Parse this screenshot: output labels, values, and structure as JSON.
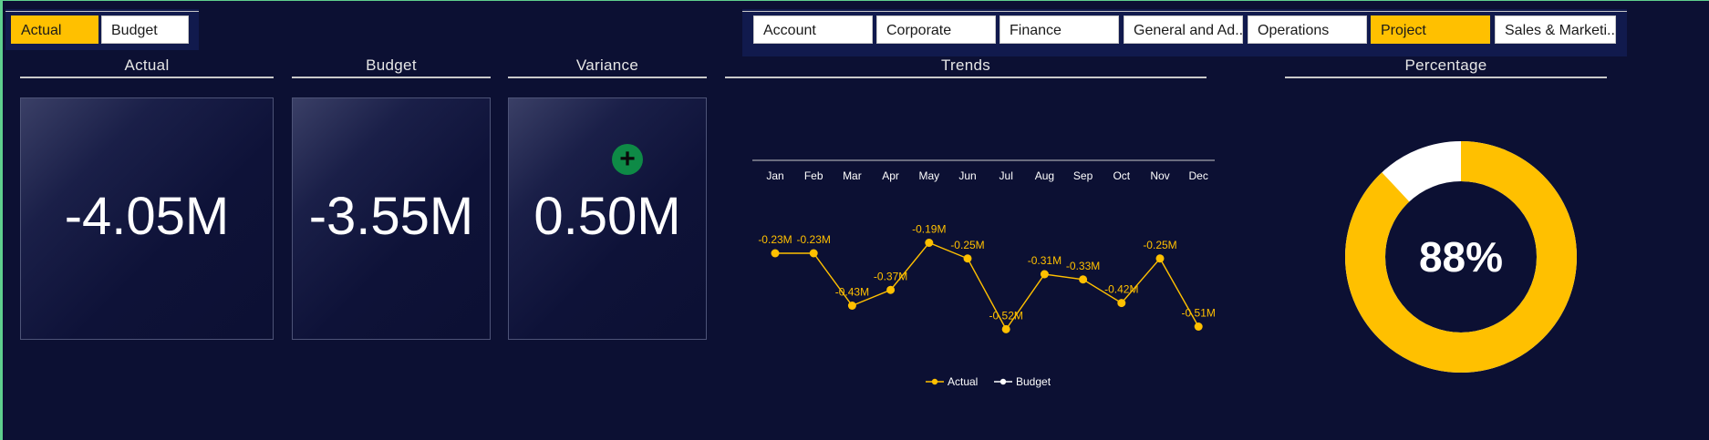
{
  "slicers": {
    "measure": [
      "Actual",
      "Budget"
    ],
    "measure_active": "Actual",
    "departments": [
      "Account",
      "Corporate",
      "Finance",
      "General and Ad...",
      "Operations",
      "Project",
      "Sales & Marketi..."
    ],
    "department_active": "Project"
  },
  "sections": {
    "actual_title": "Actual",
    "budget_title": "Budget",
    "variance_title": "Variance",
    "trends_title": "Trends",
    "percentage_title": "Percentage"
  },
  "kpis": {
    "actual": "-4.05M",
    "budget": "-3.55M",
    "variance": "0.50M",
    "variance_icon": "plus-circle-icon"
  },
  "chart_data": {
    "type": "line",
    "categories": [
      "Jan",
      "Feb",
      "Mar",
      "Apr",
      "May",
      "Jun",
      "Jul",
      "Aug",
      "Sep",
      "Oct",
      "Nov",
      "Dec"
    ],
    "series": [
      {
        "name": "Actual",
        "color": "#ffc000",
        "values": [
          -0.23,
          -0.23,
          -0.43,
          -0.37,
          -0.19,
          -0.25,
          -0.52,
          -0.31,
          -0.33,
          -0.42,
          -0.25,
          -0.51
        ],
        "labels": [
          "-0.23M",
          "-0.23M",
          "-0.43M",
          "-0.37M",
          "-0.19M",
          "-0.25M",
          "-0.52M",
          "-0.31M",
          "-0.33M",
          "-0.42M",
          "-0.25M",
          "-0.51M"
        ]
      }
    ],
    "legend": [
      "Actual",
      "Budget"
    ],
    "legend_colors": [
      "#ffc000",
      "#ffffff"
    ],
    "legend_position": "bottom",
    "x_axis_position": "top",
    "ylim": [
      -0.55,
      -0.15
    ],
    "grid": false
  },
  "percentage": {
    "value": 0.88,
    "label": "88%",
    "fill_color": "#ffc000",
    "remainder_color": "#ffffff"
  }
}
